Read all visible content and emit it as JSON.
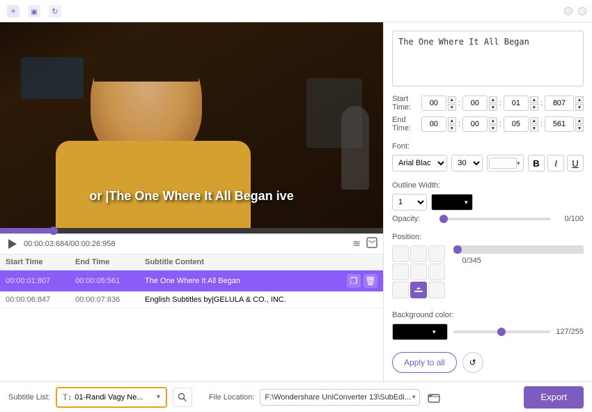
{
  "titlebar": {
    "controls": {
      "minimize": "—",
      "close": "✕"
    }
  },
  "video": {
    "subtitle_overlay": "or |The One Where It All Began ive",
    "time_current": "00:00:03:684",
    "time_total": "00:00:26:958"
  },
  "table": {
    "headers": {
      "start": "Start Time",
      "end": "End Time",
      "content": "Subtitle Content"
    },
    "rows": [
      {
        "start": "00:00:01:807",
        "end": "00:00:05:561",
        "content": "The One Where It All Began",
        "selected": true
      },
      {
        "start": "00:00:06:847",
        "end": "00:00:07:836",
        "content": "English Subtitles by|GELULA & CO., INC.",
        "selected": false
      }
    ]
  },
  "right_panel": {
    "subtitle_text": "The One Where It All Began",
    "start_time": {
      "label": "Start Time:",
      "h": "00",
      "m": "00",
      "s": "01",
      "ms": "807"
    },
    "end_time": {
      "label": "End Time:",
      "h": "00",
      "m": "00",
      "s": "05",
      "ms": "561"
    },
    "font": {
      "label": "Font:",
      "family": "Arial Blac",
      "size": "30",
      "color": "white"
    },
    "outline": {
      "label": "Outline Width:",
      "width": "1",
      "color": "black"
    },
    "opacity": {
      "label": "Opacity:",
      "value": "0/100"
    },
    "position": {
      "label": "Position:",
      "slider_value": "0/345"
    },
    "background_color": {
      "label": "Background color:",
      "value": "black",
      "slider_value": "127/255"
    },
    "apply_all_btn": "Apply to all",
    "refresh_btn": "↺"
  },
  "bottom_bar": {
    "subtitle_list_label": "Subtitle List:",
    "subtitle_list_value": "T↕ 01-Randi Vagy Ne...",
    "search_icon": "🔍",
    "file_location_label": "File Location:",
    "file_location_value": "F:\\Wondershare UniConverter 13\\SubEdi...",
    "browse_icon": "📁",
    "export_btn": "Export"
  },
  "icons": {
    "play": "▶",
    "waveform": "≋",
    "expand": "⛶",
    "bold": "B",
    "italic": "I",
    "underline": "U",
    "copy": "❐",
    "delete": "🗑",
    "refresh": "↺"
  }
}
